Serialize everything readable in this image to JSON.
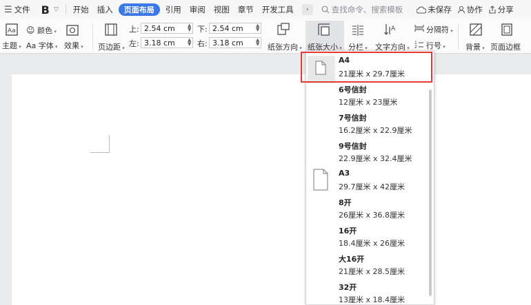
{
  "menubar": {
    "file": "文件",
    "format_b": "B",
    "tabs": [
      "开始",
      "插入",
      "页面布局",
      "引用",
      "审阅",
      "视图",
      "章节",
      "开发工具"
    ],
    "active_tab": "页面布局",
    "search_placeholder": "查找命令、搜索模板",
    "unsaved": "未保存",
    "collab": "协作",
    "share": "分享"
  },
  "ribbon": {
    "theme": "主题",
    "color": "颜色",
    "font": "Aa 字体",
    "effect": "效果",
    "margins": "页边距",
    "top_label": "上:",
    "top_value": "2.54 cm",
    "bottom_label": "下:",
    "bottom_value": "2.54 cm",
    "left_label": "左:",
    "left_value": "3.18 cm",
    "right_label": "右:",
    "right_value": "3.18 cm",
    "orientation": "纸张方向",
    "size": "纸张大小",
    "columns": "分栏",
    "text_direction": "文字方向",
    "breaks": "分隔符",
    "line_numbers": "行号",
    "background": "背景",
    "page_border": "页面边框"
  },
  "paper_sizes": [
    {
      "name": "A4",
      "dims": "21厘米 x 29.7厘米",
      "icon": "doc-icon",
      "selected": true
    },
    {
      "name": "6号信封",
      "dims": "12厘米 x 23厘米",
      "icon": "",
      "selected": false
    },
    {
      "name": "7号信封",
      "dims": "16.2厘米 x 22.9厘米",
      "icon": "",
      "selected": false
    },
    {
      "name": "9号信封",
      "dims": "22.9厘米 x 32.4厘米",
      "icon": "",
      "selected": false
    },
    {
      "name": "A3",
      "dims": "29.7厘米 x 42厘米",
      "icon": "doc-icon",
      "selected": false
    },
    {
      "name": "8开",
      "dims": "26厘米 x 36.8厘米",
      "icon": "",
      "selected": false
    },
    {
      "name": "16开",
      "dims": "18.4厘米 x 26厘米",
      "icon": "",
      "selected": false
    },
    {
      "name": "大16开",
      "dims": "21厘米 x 28.5厘米",
      "icon": "",
      "selected": false
    },
    {
      "name": "32开",
      "dims": "13厘米 x 18.4厘米",
      "icon": "",
      "selected": false
    }
  ],
  "colors": {
    "accent": "#3a78e8",
    "highlight": "#e53935"
  }
}
